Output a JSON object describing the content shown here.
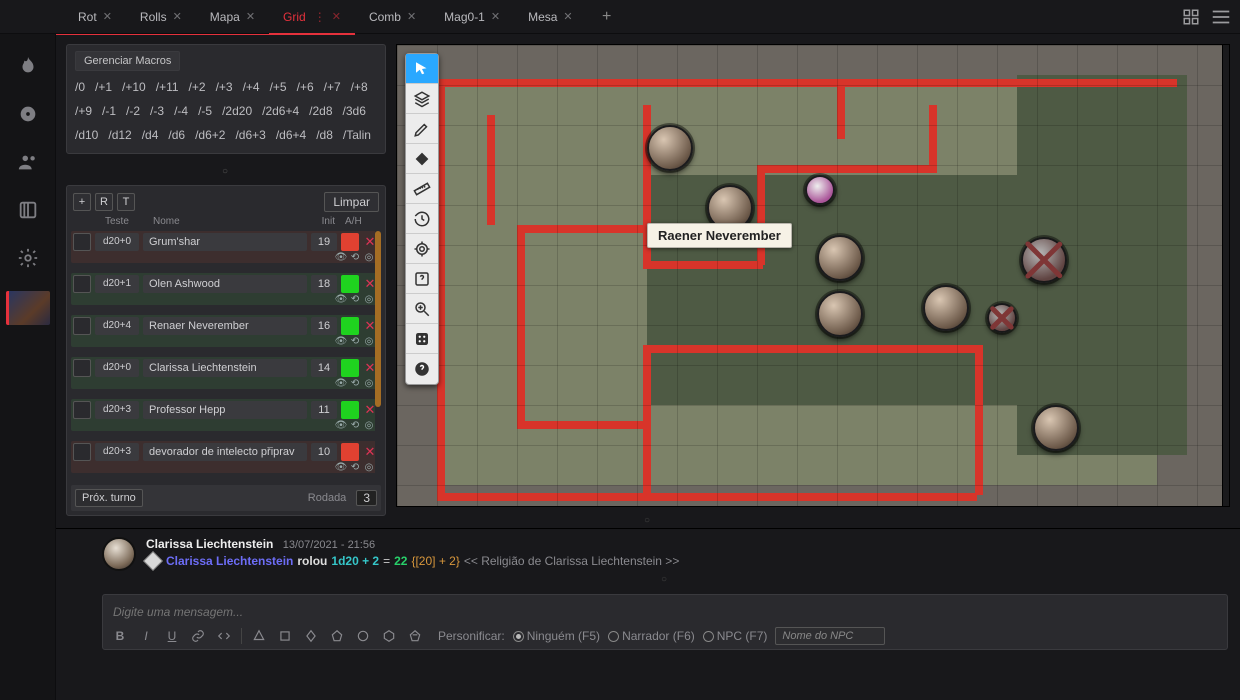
{
  "tabs": [
    {
      "label": "Rot",
      "active": false
    },
    {
      "label": "Rolls",
      "active": false
    },
    {
      "label": "Mapa",
      "active": false
    },
    {
      "label": "Grid",
      "active": true,
      "hasOptions": true
    },
    {
      "label": "Comb",
      "active": false
    },
    {
      "label": "Mag0-1",
      "active": false
    },
    {
      "label": "Mesa",
      "active": false
    }
  ],
  "macros": {
    "title": "Gerenciar Macros",
    "items": [
      "/0",
      "/+1",
      "/+10",
      "/+11",
      "/+2",
      "/+3",
      "/+4",
      "/+5",
      "/+6",
      "/+7",
      "/+8",
      "/+9",
      "/-1",
      "/-2",
      "/-3",
      "/-4",
      "/-5",
      "/2d20",
      "/2d6+4",
      "/2d8",
      "/3d6",
      "/d10",
      "/d12",
      "/d4",
      "/d6",
      "/d6+2",
      "/d6+3",
      "/d6+4",
      "/d8",
      "/Talin"
    ]
  },
  "init_header": {
    "add": "+",
    "r": "R",
    "t": "T",
    "clear": "Limpar",
    "col_test": "Teste",
    "col_name": "Nome",
    "col_init": "Init",
    "col_ah": "A/H"
  },
  "init": [
    {
      "test": "d20+0",
      "name": "Grum'shar",
      "init": "19",
      "side": "enemy"
    },
    {
      "test": "d20+1",
      "name": "Olen Ashwood",
      "init": "18",
      "side": "ally"
    },
    {
      "test": "d20+4",
      "name": "Renaer Neverember",
      "init": "16",
      "side": "ally"
    },
    {
      "test": "d20+0",
      "name": "Clarissa Liechtenstein",
      "init": "14",
      "side": "ally"
    },
    {
      "test": "d20+3",
      "name": "Professor Hepp",
      "init": "11",
      "side": "ally"
    },
    {
      "test": "d20+3",
      "name": "devorador de intelecto připrav",
      "init": "10",
      "side": "enemy"
    }
  ],
  "init_footer": {
    "next": "Próx. turno",
    "round_label": "Rodada",
    "round": "3"
  },
  "map": {
    "tooltip_name": "Raener Neverember",
    "tools": [
      "pointer",
      "layers",
      "draw",
      "shapes",
      "ruler",
      "history",
      "target",
      "help-map",
      "zoom-in",
      "dice",
      "help"
    ]
  },
  "chat": {
    "message": {
      "author": "Clarissa Liechtenstein",
      "timestamp": "13/07/2021 - 21:56",
      "player": "Clarissa Liechtenstein",
      "verb": "rolou",
      "roll": "1d20 + 2",
      "eq": "=",
      "result": "22",
      "detail": "{[20] + 2}",
      "context": "<< Religião de Clarissa Liechtenstein >>"
    },
    "placeholder": "Digite uma mensagem...",
    "format": {
      "persona_label": "Personificar:",
      "opt_none": "Ninguém (F5)",
      "opt_narr": "Narrador (F6)",
      "opt_npc": "NPC (F7)",
      "npc_placeholder": "Nome do NPC"
    }
  }
}
